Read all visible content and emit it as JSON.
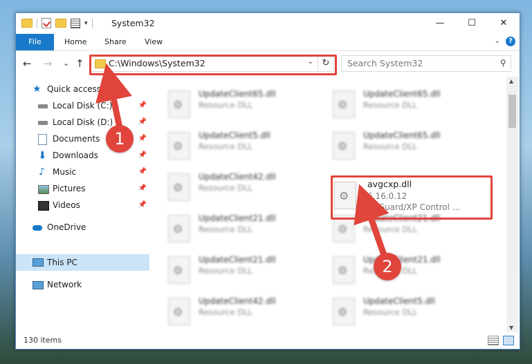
{
  "window": {
    "title": "System32",
    "controls": {
      "minimize": "—",
      "maximize": "☐",
      "close": "✕"
    }
  },
  "ribbon": {
    "tabs": [
      "File",
      "Home",
      "Share",
      "View"
    ],
    "help_label": "?"
  },
  "navigation": {
    "back_icon": "←",
    "forward_icon": "→",
    "recent_icon": "⌄",
    "up_icon": "↑",
    "address": "C:\\Windows\\System32",
    "refresh_icon": "↻",
    "search_placeholder": "Search System32"
  },
  "sidebar": {
    "items": [
      {
        "label": "Quick access",
        "icon": "star-icon",
        "pinned": false
      },
      {
        "label": "Local Disk (C:)",
        "icon": "drive-icon",
        "pinned": true
      },
      {
        "label": "Local Disk (D:)",
        "icon": "drive-icon",
        "pinned": true
      },
      {
        "label": "Documents",
        "icon": "documents-icon",
        "pinned": true
      },
      {
        "label": "Downloads",
        "icon": "downloads-icon",
        "pinned": true
      },
      {
        "label": "Music",
        "icon": "music-icon",
        "pinned": true
      },
      {
        "label": "Pictures",
        "icon": "pictures-icon",
        "pinned": true
      },
      {
        "label": "Videos",
        "icon": "videos-icon",
        "pinned": true
      },
      {
        "label": "OneDrive",
        "icon": "cloud-icon",
        "pinned": false
      },
      {
        "label": "This PC",
        "icon": "computer-icon",
        "pinned": false,
        "selected": true
      },
      {
        "label": "Network",
        "icon": "network-icon",
        "pinned": false
      }
    ]
  },
  "files": {
    "left_column": [
      {
        "name": "UpdateClient65.dll",
        "desc": "Resource DLL"
      },
      {
        "name": "UpdateClient5.dll",
        "desc": "Resource DLL"
      },
      {
        "name": "UpdateClient42.dll",
        "desc": "Resource DLL"
      },
      {
        "name": "UpdateClient21.dll",
        "desc": "Resource DLL"
      },
      {
        "name": "UpdateClient21.dll",
        "desc": "Resource DLL"
      },
      {
        "name": "UpdateClient42.dll",
        "desc": "Resource DLL"
      }
    ],
    "right_column": [
      {
        "name": "UpdateClient65.dll",
        "desc": "Resource DLL"
      },
      {
        "name": "UpdateClient65.dll",
        "desc": "Resource DLL"
      },
      {
        "name": "UpdateClient21.dll",
        "desc": "Resource DLL"
      },
      {
        "name": "UpdateClient21.dll",
        "desc": "Resource DLL"
      },
      {
        "name": "UpdateClient5.dll",
        "desc": "Resource DLL"
      }
    ],
    "highlighted": {
      "name": "avgcxp.dll",
      "version": "6.16.0.12",
      "desc": "AVGuard/XP Control ..."
    }
  },
  "status": {
    "item_count": "130 items"
  },
  "annotations": {
    "badge1": "1",
    "badge2": "2",
    "color": "#e0443b"
  }
}
